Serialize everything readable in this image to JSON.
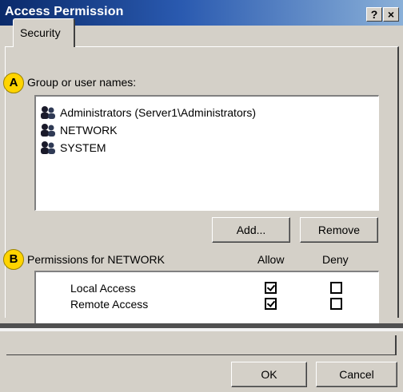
{
  "window": {
    "title": "Access Permission",
    "help_icon_label": "?",
    "close_icon_label": "×"
  },
  "tabs": [
    {
      "label": "Security",
      "selected": true
    }
  ],
  "callouts": {
    "a": "A",
    "b": "B"
  },
  "group_section": {
    "label": "Group or user names:",
    "users": [
      {
        "name": "Administrators (Server1\\Administrators)",
        "icon": "users-group-icon"
      },
      {
        "name": "NETWORK",
        "icon": "users-group-icon"
      },
      {
        "name": "SYSTEM",
        "icon": "users-group-icon"
      }
    ],
    "add_label": "Add...",
    "remove_label": "Remove"
  },
  "permissions_section": {
    "label": "Permissions for NETWORK",
    "allow_header": "Allow",
    "deny_header": "Deny",
    "rows": [
      {
        "name": "Local Access",
        "allow": true,
        "deny": false
      },
      {
        "name": "Remote Access",
        "allow": true,
        "deny": false
      }
    ]
  },
  "footer": {
    "ok_label": "OK",
    "cancel_label": "Cancel"
  },
  "colors": {
    "titlebar_start": "#0a2a6a",
    "titlebar_end": "#8ab0d8",
    "dialog_bg": "#d4d0c8",
    "callout": "#ffd400"
  }
}
